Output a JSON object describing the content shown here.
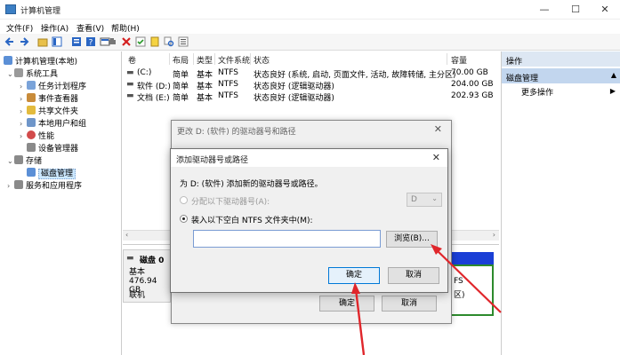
{
  "window": {
    "title": "计算机管理",
    "minimize": "—",
    "maximize": "☐",
    "close": "✕"
  },
  "menu": [
    "文件(F)",
    "操作(A)",
    "查看(V)",
    "帮助(H)"
  ],
  "tree": {
    "root": "计算机管理(本地)",
    "system_tools": "系统工具",
    "task_scheduler": "任务计划程序",
    "event_viewer": "事件查看器",
    "shared_folders": "共享文件夹",
    "local_users": "本地用户和组",
    "performance": "性能",
    "device_manager": "设备管理器",
    "storage": "存储",
    "disk_management": "磁盘管理",
    "services": "服务和应用程序"
  },
  "table": {
    "headers": [
      "卷",
      "布局",
      "类型",
      "文件系统",
      "状态",
      "容量"
    ],
    "rows": [
      [
        "(C:)",
        "简单",
        "基本",
        "NTFS",
        "状态良好 (系统, 启动, 页面文件, 活动, 故障转储, 主分区)",
        "70.00 GB"
      ],
      [
        "软件 (D:)",
        "简单",
        "基本",
        "NTFS",
        "状态良好 (逻辑驱动器)",
        "204.00 GB"
      ],
      [
        "文档 (E:)",
        "简单",
        "基本",
        "NTFS",
        "状态良好 (逻辑驱动器)",
        "202.93 GB"
      ]
    ]
  },
  "disk": {
    "name": "磁盘 0",
    "type": "基本",
    "size": "476.94 GB",
    "status": "联机",
    "fs_hint": "FS",
    "drive_hint": "区)"
  },
  "actions": {
    "header": "操作",
    "section": "磁盘管理",
    "more": "更多操作"
  },
  "dialog_back": {
    "title": "更改 D: (软件) 的驱动器号和路径",
    "ok": "确定",
    "cancel": "取消"
  },
  "dialog_front": {
    "title": "添加驱动器号或路径",
    "instruction": "为 D: (软件) 添加新的驱动器号或路径。",
    "option_letter": "分配以下驱动器号(A):",
    "letter_value": "D",
    "option_folder": "装入以下空白 NTFS 文件夹中(M):",
    "path_value": "",
    "browse": "浏览(B)...",
    "ok": "确定",
    "cancel": "取消"
  },
  "colors": {
    "accent_red": "#e0262b",
    "selection": "#cce8ff",
    "volume_blue": "#1a3fd6",
    "volume_green": "#2d8a2d"
  }
}
